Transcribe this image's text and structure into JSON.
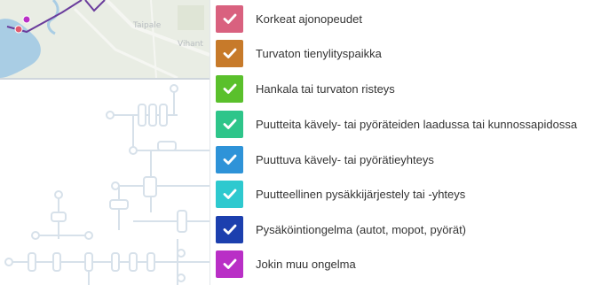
{
  "map": {
    "place_labels": [
      "Taipale",
      "Vihant"
    ]
  },
  "filter_panel": {
    "items": [
      {
        "label": "Korkeat ajonopeudet",
        "color": "#d9617f",
        "checked": true
      },
      {
        "label": "Turvaton tienylityspaikka",
        "color": "#c77a2a",
        "checked": true
      },
      {
        "label": "Hankala tai turvaton risteys",
        "color": "#5ac02c",
        "checked": true
      },
      {
        "label": "Puutteita kävely- tai pyöräteiden laadussa tai kunnossapidossa",
        "color": "#2ec58a",
        "checked": true
      },
      {
        "label": "Puuttuva kävely- tai pyörätieyhteys",
        "color": "#2e93d8",
        "checked": true
      },
      {
        "label": "Puutteellinen pysäkkijärjestely tai -yhteys",
        "color": "#2ec9cf",
        "checked": true
      },
      {
        "label": "Pysäköintiongelma (autot, mopot, pyörät)",
        "color": "#1c3fae",
        "checked": true
      },
      {
        "label": "Jokin muu ongelma",
        "color": "#b92fc6",
        "checked": true
      }
    ]
  }
}
